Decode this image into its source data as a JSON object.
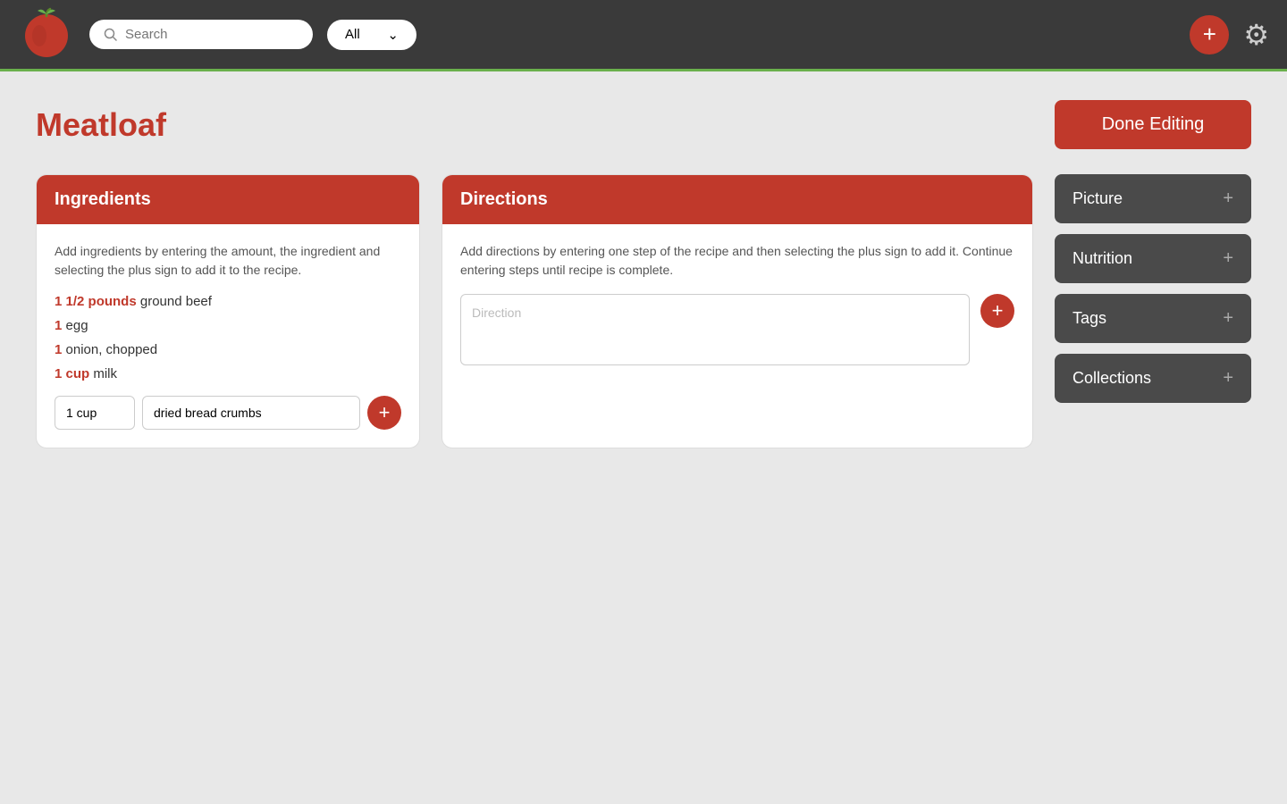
{
  "header": {
    "search_placeholder": "Search",
    "filter_value": "All",
    "add_label": "+",
    "settings_icon": "⚙"
  },
  "page": {
    "title": "Meatloaf",
    "done_editing_label": "Done Editing"
  },
  "ingredients": {
    "header": "Ingredients",
    "help_text": "Add ingredients by entering the amount, the ingredient and selecting the plus sign to add it to the recipe.",
    "items": [
      {
        "qty": "1 1/2 pounds",
        "name": "ground beef"
      },
      {
        "qty": "1",
        "name": "egg"
      },
      {
        "qty": "1",
        "name": "onion, chopped"
      },
      {
        "qty": "1 cup",
        "name": "milk"
      }
    ],
    "qty_input_value": "1 cup",
    "name_input_value": "dried bread crumbs",
    "add_button_label": "+"
  },
  "directions": {
    "header": "Directions",
    "help_text": "Add directions by entering one step of the recipe and then selecting the plus sign to add it. Continue entering steps until recipe is complete.",
    "placeholder": "Direction",
    "add_button_label": "+"
  },
  "sidebar": {
    "buttons": [
      {
        "label": "Picture",
        "icon": "+"
      },
      {
        "label": "Nutrition",
        "icon": "+"
      },
      {
        "label": "Tags",
        "icon": "+"
      },
      {
        "label": "Collections",
        "icon": "+"
      }
    ]
  },
  "colors": {
    "accent": "#c0392b",
    "dark_header": "#3a3a3a",
    "dark_btn": "#4a4a4a"
  }
}
